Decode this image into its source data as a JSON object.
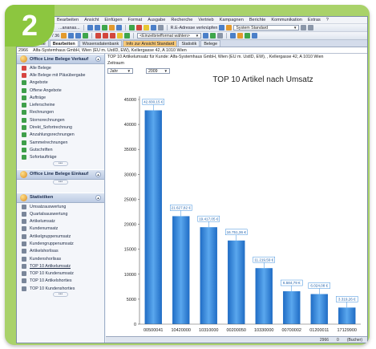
{
  "badge": {
    "number": "2"
  },
  "menu": {
    "items": [
      "Bearbeiten",
      "Ansicht",
      "Einfügen",
      "Format",
      "Ausgabe",
      "Recherche",
      "Vertrieb",
      "Kampagnen",
      "Berichte",
      "Kommunikation",
      "Extras",
      "?"
    ]
  },
  "toolbar1": {
    "label_left": "...ananas...",
    "address_combo": "R.E-Adresse verknüpfen",
    "system_combo": "System Standard"
  },
  "toolbar2": {
    "zoom_label": "Arbeitsflächen 0 / 36",
    "format_combo": "<Einzelbriefformat wählen>"
  },
  "tabs": [
    {
      "label": "Adresse",
      "active": false,
      "orange": false
    },
    {
      "label": "Bearbeiten",
      "active": true,
      "orange": false
    },
    {
      "label": "Wissensdatenbank",
      "active": false,
      "orange": false
    },
    {
      "label": "Info zur Ansicht Standard",
      "active": false,
      "orange": true
    },
    {
      "label": "Statistik",
      "active": false,
      "orange": false
    },
    {
      "label": "Belege",
      "active": false,
      "orange": false
    }
  ],
  "address": {
    "id": "2966",
    "text": "Alfa-Systemhaus GmbH, Wien (EU m. UstID, EW), Kellergasse 42, A 1010 Wien"
  },
  "sidebar": {
    "sections": [
      {
        "title": "Office Line Belege Verkauf",
        "items": [
          {
            "label": "Alle Belege",
            "icon": "red"
          },
          {
            "label": "Alle Belege mit Pläsübergabe",
            "icon": "red"
          },
          {
            "label": "Angebote",
            "icon": "green"
          },
          {
            "label": "Offene Angebote",
            "icon": "green"
          },
          {
            "label": "Aufträge",
            "icon": "green"
          },
          {
            "label": "Lieferscheine",
            "icon": "green"
          },
          {
            "label": "Rechnungen",
            "icon": "green"
          },
          {
            "label": "Stornorechnungen",
            "icon": "green"
          },
          {
            "label": "Direkt_Sofortrechnung",
            "icon": "green"
          },
          {
            "label": "Anzahlungsrechnungen",
            "icon": "green"
          },
          {
            "label": "Sammelrechnungen",
            "icon": "green"
          },
          {
            "label": "Gutschriften",
            "icon": "green"
          },
          {
            "label": "Sofortaufträge",
            "icon": "green"
          }
        ]
      },
      {
        "title": "Office Line Belege Einkauf",
        "items": []
      },
      {
        "title": "Statistiken",
        "items": [
          {
            "label": "Umsatzauswertung",
            "icon": "gray"
          },
          {
            "label": "Quartalsauswertung",
            "icon": "gray"
          },
          {
            "label": "Artikelumsatz",
            "icon": "gray"
          },
          {
            "label": "Kundenumsatz",
            "icon": "gray"
          },
          {
            "label": "Artikelgruppenumsatz",
            "icon": "gray"
          },
          {
            "label": "Kundengruppenumsatz",
            "icon": "gray"
          },
          {
            "label": "Artikelshorlisas",
            "icon": "gray"
          },
          {
            "label": "Kundenshorlisas",
            "icon": "gray"
          },
          {
            "label": "TOP 10 Artikelumsatz",
            "icon": "gray",
            "active": true
          },
          {
            "label": "TOP 10 Kundenumsatz",
            "icon": "gray"
          },
          {
            "label": "TOP 10 Artikelshorties",
            "icon": "gray"
          },
          {
            "label": "TOP 10 Kundenshorties",
            "icon": "gray"
          }
        ]
      }
    ]
  },
  "main": {
    "breadcrumb": "TOP 10 Artikelumsatz für Kunde: Alfa-Systemhaus GmbH, Wien (EU m. UstID, EW), , Kellergasse 42, A 1010 Wien",
    "zeitraum_label": "Zeitraum",
    "period_value": "Jahr",
    "year_value": "2009"
  },
  "chart_data": {
    "type": "bar",
    "title": "TOP 10 Artikel nach Umsatz",
    "categories": [
      "00500041",
      "10420000",
      "10310000",
      "00200050",
      "10330000",
      "00700002",
      "01200011",
      "17129900"
    ],
    "values": [
      42830.15,
      21627.82,
      19417.05,
      16751.36,
      11219.59,
      6584.79,
      6024.08,
      3319.26
    ],
    "data_labels": [
      "42.830,15 €",
      "21.627,82 €",
      "19.417,05 €",
      "16.751,36 €",
      "11.219,59 €",
      "6.584,79 €",
      "6.024,08 €",
      "3.319,26 €"
    ],
    "yticks": [
      0,
      5000,
      10000,
      15000,
      20000,
      25000,
      30000,
      35000,
      40000,
      45000
    ],
    "ylim": [
      0,
      45000
    ],
    "grid": false,
    "bar_color": "#3d8fdd"
  },
  "status": {
    "left": "2966",
    "middle": "0",
    "right": "(Bucher)"
  }
}
